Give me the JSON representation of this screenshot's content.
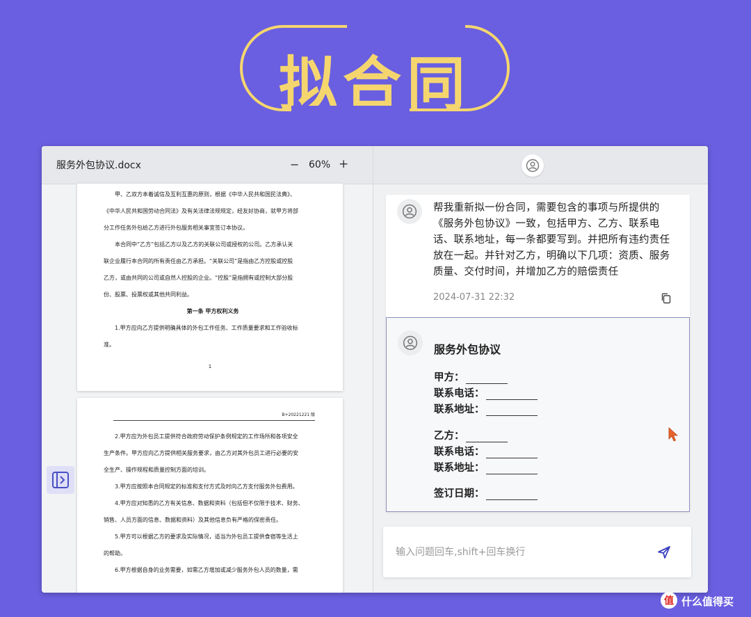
{
  "banner": {
    "title": "拟合同"
  },
  "document": {
    "filename": "服务外包协议.docx",
    "zoom_minus": "−",
    "zoom": "60%",
    "zoom_plus": "+",
    "page1": {
      "lines": [
        "甲、乙双方本着诚信及互利互惠的原则，根据《中华人民共和国民法典》、",
        "《中华人民共和国劳动合同法》及有关法律法规规定，经友好协商，就甲方将部",
        "分工作任务外包给乙方进行外包服务相关事宜签订本协议。",
        "本合同中“乙方”包括乙方以及乙方的关联公司或授权的公司。乙方承认关",
        "联企业履行本合同的所有责任由乙方承担。“关联公司”是指由乙方控股或控股",
        "乙方，或由共同的公司或自然人控股的企业。“控股”是指拥有或控制大部分股",
        "份、股票、投票权或其他共同利益。"
      ],
      "section_title": "第一条 甲方权利义务",
      "lines_after": [
        "1.甲方应向乙方提供明确具体的外包工作任务、工作质量要求和工作验收标",
        "准。"
      ],
      "page_number": "1"
    },
    "page2": {
      "header_code": "B+20221221 版",
      "lines": [
        "2.甲方应为外包员工提供符合政府劳动保护条例规定的工作场所和各项安全",
        "生产条件。甲方应向乙方提供相关服务要求，由乙方对其外包员工进行必要的安",
        "全生产、操作规程和质量控制方面的培训。",
        "3.甲方应按照本合同规定的标准和支付方式及时向乙方支付服务外包费用。",
        "4.甲方应对知悉的乙方有关信息、数据和资料（包括但不仅限于技术、财务、",
        "销售、人员方面的信息、数据和资料）及其他信息负有严格的保密责任。",
        "5.甲方可以根据乙方的要求及实际情况，适当为外包员工提供食宿等生活上",
        "的帮助。",
        "6.甲方根据自身的业务需要，如需乙方增加或减少服务外包人员的数量，需"
      ]
    }
  },
  "chat": {
    "user_message": {
      "text": "帮我重新拟一份合同，需要包含的事项与所提供的《服务外包协议》一致，包括甲方、乙方、联系电话、联系地址，每一条都要写到。并把所有违约责任放在一起。并针对乙方，明确以下几项：资质、服务质量、交付时间，并增加乙方的赔偿责任",
      "timestamp": "2024-07-31 22:32"
    },
    "ai_message": {
      "title": "服务外包协议",
      "party_a": "甲方：",
      "party_a_phone": "联系电话：",
      "party_a_address": "联系地址：",
      "party_b": "乙方：",
      "party_b_phone": "联系电话：",
      "party_b_address": "联系地址：",
      "sign_date": "签订日期："
    },
    "input": {
      "placeholder": "输入问题回车,shift+回车换行",
      "value": ""
    }
  },
  "icons": {
    "avatar": "user-circle-icon",
    "copy": "copy-icon",
    "send": "send-icon",
    "sidebar_toggle": "sidebar-expand-icon",
    "cursor": "mouse-pointer-icon"
  },
  "colors": {
    "background": "#6a5fe0",
    "banner_accent": "#f5d66e",
    "send_icon": "#3b3fbf",
    "cursor": "#e8642c"
  },
  "watermark": {
    "logo": "值",
    "text": "什么值得买"
  }
}
